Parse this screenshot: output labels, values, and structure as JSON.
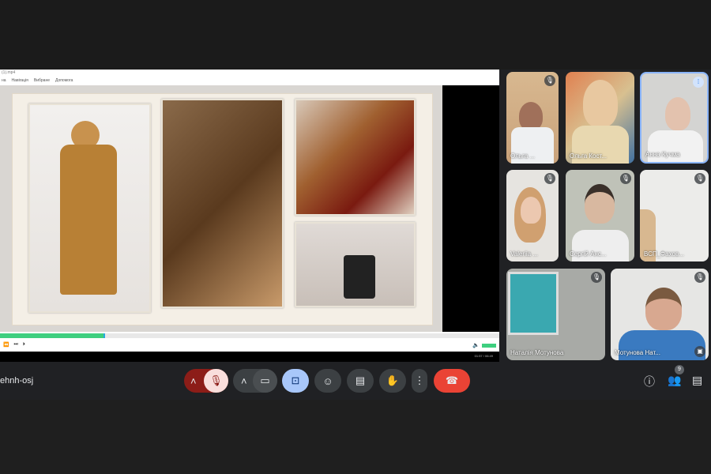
{
  "meeting_code": "ehnh-osj",
  "share": {
    "window_title": "(1).mp4",
    "menu": [
      "на",
      "Навігація",
      "Вибране",
      "Допомога"
    ],
    "progress": 0.21,
    "time": "01:57 / 06:49",
    "volume": 1.0
  },
  "participants": [
    {
      "name": "Ольга ...",
      "muted": true
    },
    {
      "name": "Ольга Кост...",
      "muted": false
    },
    {
      "name": "Анна Кучма",
      "muted": false,
      "speaking": true
    },
    {
      "name": "Valeriia ...",
      "muted": true
    },
    {
      "name": "Сергій Анс...",
      "muted": true
    },
    {
      "name": "ВСП_Фахов...",
      "muted": true
    },
    {
      "name": "Наталія Мотунова",
      "muted": true
    },
    {
      "name": "Мотунова Нат...",
      "muted": true
    }
  ],
  "people_count": "9",
  "colors": {
    "accent": "#8ab4f8",
    "end_call": "#ea4335",
    "mic_off": "#f9dedc"
  }
}
